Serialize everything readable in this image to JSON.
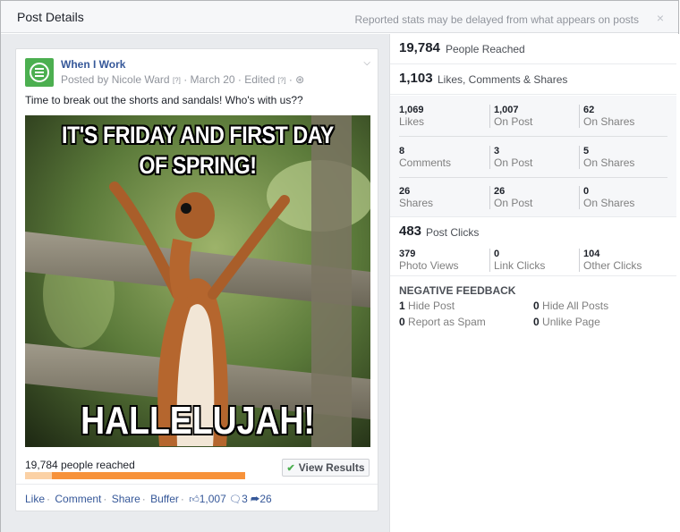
{
  "dialog": {
    "title": "Post Details",
    "note": "Reported stats may be delayed from what appears on posts",
    "close": "×"
  },
  "post": {
    "page_name": "When I Work",
    "meta": {
      "posted_by": "Posted by Nicole Ward",
      "q1": "[?]",
      "date": "· March 20 · Edited",
      "q2": "[?]",
      "globe": "· ⊛"
    },
    "text": "Time to break out the shorts and sandals! Who's with us??",
    "image": {
      "top_text": "IT'S FRIDAY AND FIRST DAY OF SPRING!",
      "bottom_text": "HALLELUJAH!"
    },
    "reach_label": "19,784 people reached",
    "reach_bar": {
      "organic_fraction": 0.12,
      "paid_color": "#f7923a",
      "organic_color": "#fbd1a5"
    },
    "view_results": "View Results",
    "actions": {
      "like": "Like",
      "comment": "Comment",
      "share": "Share",
      "buffer": "Buffer",
      "likes_count": "1,007",
      "comments_count": "3",
      "shares_count": "26"
    }
  },
  "stats": {
    "people_reached": {
      "value": "19,784",
      "label": "People Reached"
    },
    "engagement": {
      "value": "1,103",
      "label": "Likes, Comments & Shares"
    },
    "likes": [
      {
        "value": "1,069",
        "label": "Likes"
      },
      {
        "value": "1,007",
        "label": "On Post"
      },
      {
        "value": "62",
        "label": "On Shares"
      }
    ],
    "comments": [
      {
        "value": "8",
        "label": "Comments"
      },
      {
        "value": "3",
        "label": "On Post"
      },
      {
        "value": "5",
        "label": "On Shares"
      }
    ],
    "shares": [
      {
        "value": "26",
        "label": "Shares"
      },
      {
        "value": "26",
        "label": "On Post"
      },
      {
        "value": "0",
        "label": "On Shares"
      }
    ],
    "post_clicks": {
      "value": "483",
      "label": "Post Clicks"
    },
    "clicks": [
      {
        "value": "379",
        "label": "Photo Views"
      },
      {
        "value": "0",
        "label": "Link Clicks"
      },
      {
        "value": "104",
        "label": "Other Clicks"
      }
    ],
    "negative": {
      "title": "NEGATIVE FEEDBACK",
      "items": [
        {
          "value": "1",
          "label": "Hide Post"
        },
        {
          "value": "0",
          "label": "Hide All Posts"
        },
        {
          "value": "0",
          "label": "Report as Spam"
        },
        {
          "value": "0",
          "label": "Unlike Page"
        }
      ]
    }
  },
  "colors": {
    "link": "#365899",
    "brand_green": "#4caf50",
    "bar_orange": "#f7923a"
  }
}
